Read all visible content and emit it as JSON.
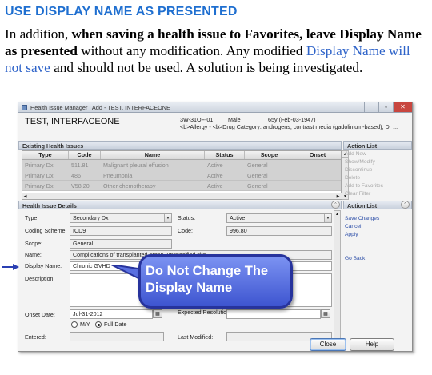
{
  "header": {
    "title": "USE DISPLAY NAME AS PRESENTED"
  },
  "paragraph": {
    "t1": "In addition, ",
    "b1": "when saving a health issue to Favorites, leave Display Name as presented",
    "t2": " without any modification.  Any modified ",
    "blue": "Display Name will not save",
    "t3": " and should not be used. A solution is being investigated."
  },
  "window": {
    "title": "Health Issue Manager | Add - TEST, INTERFACEONE",
    "buttons": {
      "minimize": "_",
      "restore": "▫",
      "close": "✕"
    },
    "patient": {
      "name": "TEST, INTERFACEONE",
      "id": "3W-31OF-01",
      "sex": "Male",
      "age_dob": "65y (Feb-03-1947)",
      "allergy": "<b>Allergy - <b>Drug Category: androgens, contrast media (gadolinium-based); Dr ..."
    },
    "existing": {
      "title": "Existing Health Issues",
      "columns": [
        "Type",
        "Code",
        "Name",
        "Status",
        "Scope",
        "Onset"
      ],
      "rows": [
        [
          "Primary Dx",
          "511.81",
          "Malignant pleural effusion",
          "Active",
          "General",
          ""
        ],
        [
          "Primary Dx",
          "486",
          "Pneumonia",
          "Active",
          "General",
          ""
        ],
        [
          "Primary Dx",
          "V58.20",
          "Other chemotherapy",
          "Active",
          "General",
          ""
        ]
      ]
    },
    "action_list_top": {
      "title": "Action List",
      "items": [
        "Add New",
        "Show/Modify",
        "Discontinue",
        "Delete",
        "Add to Favorites",
        "Clear Filter"
      ]
    },
    "details": {
      "title": "Health Issue Details",
      "type_label": "Type:",
      "type_value": "Secondary Dx",
      "status_label": "Status:",
      "status_value": "Active",
      "coding_label": "Coding Scheme:",
      "coding_value": "ICD9",
      "code_label": "Code:",
      "code_value": "996.80",
      "scope_label": "Scope:",
      "scope_value": "General",
      "name_label": "Name:",
      "name_value": "Complications of transplanted organ, unspecified site",
      "display_label": "Display Name:",
      "display_value": "Chronic GVHD",
      "description_label": "Description:",
      "onset_label": "Onset Date:",
      "onset_value": "Jul-31-2012",
      "my_label": "M/Y",
      "fulldate_label": "Full Date",
      "expected_label": "Expected Resolution:",
      "entered_label": "Entered:",
      "modified_label": "Last Modified:"
    },
    "action_list_bottom": {
      "title": "Action List",
      "items": [
        "Save Changes",
        "Cancel",
        "Apply"
      ],
      "goback": "Go Back"
    },
    "footer": {
      "close": "Close",
      "help": "Help"
    }
  },
  "callout": {
    "line1": "Do Not Change The",
    "line2": "Display Name"
  },
  "colors": {
    "heading_blue": "#1f6fd0",
    "callout_fill": "#4a60d8",
    "arrow_blue": "#2a3fb3"
  }
}
